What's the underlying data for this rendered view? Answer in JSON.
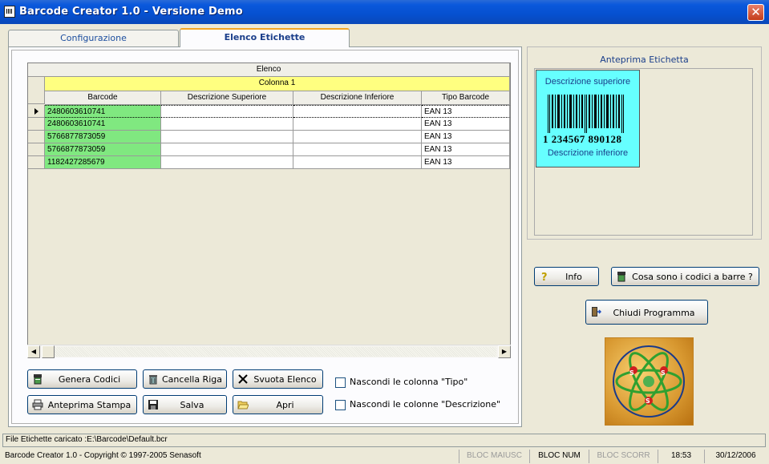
{
  "window": {
    "title": "Barcode Creator 1.0 - Versione Demo",
    "close_glyph": "✕"
  },
  "tabs": [
    {
      "label": "Configurazione",
      "active": false
    },
    {
      "label": "Elenco Etichette",
      "active": true
    }
  ],
  "grid": {
    "caption": "Elenco",
    "group_header": "Colonna 1",
    "columns": [
      "Barcode",
      "Descrizione Superiore",
      "Descrizione Inferiore",
      "Tipo Barcode"
    ],
    "rows": [
      {
        "barcode": "2480603610741",
        "desc_sup": "",
        "desc_inf": "",
        "tipo": "EAN 13",
        "current": true
      },
      {
        "barcode": "2480603610741",
        "desc_sup": "",
        "desc_inf": "",
        "tipo": "EAN 13",
        "current": false
      },
      {
        "barcode": "5766877873059",
        "desc_sup": "",
        "desc_inf": "",
        "tipo": "EAN 13",
        "current": false
      },
      {
        "barcode": "5766877873059",
        "desc_sup": "",
        "desc_inf": "",
        "tipo": "EAN 13",
        "current": false
      },
      {
        "barcode": "1182427285679",
        "desc_sup": "",
        "desc_inf": "",
        "tipo": "EAN 13",
        "current": false
      }
    ]
  },
  "buttons": {
    "genera": "Genera Codici",
    "cancella": "Cancella Riga",
    "svuota": "Svuota Elenco",
    "anteprima": "Anteprima Stampa",
    "salva": "Salva",
    "apri": "Apri",
    "info": "Info",
    "cosa": "Cosa sono i codici a barre ?",
    "chiudi": "Chiudi Programma"
  },
  "options": {
    "nascondi_tipo": {
      "label": "Nascondi le colonna \"Tipo\"",
      "checked": false
    },
    "nascondi_desc": {
      "label": "Nascondi le colonne \"Descrizione\"",
      "checked": false
    }
  },
  "preview": {
    "title": "Anteprima Etichetta",
    "desc_top": "Descrizione superiore",
    "number": "1 234567 890128",
    "desc_bottom": "Descrizione inferiore"
  },
  "status": {
    "file": "File Etichette caricato :E:\\Barcode\\Default.bcr",
    "copyright": "Barcode Creator 1.0 - Copyright © 1997-2005 Senasoft",
    "caps": "BLOC MAIUSC",
    "num": "BLOC NUM",
    "scroll": "BLOC SCORR",
    "time": "18:53",
    "date": "30/12/2006"
  },
  "colors": {
    "title_bar": "#0a58dc",
    "barcode_cell": "#80e880",
    "group_header": "#ffff80",
    "label_bg": "#66ffff",
    "tab_accent": "#f5a623"
  }
}
